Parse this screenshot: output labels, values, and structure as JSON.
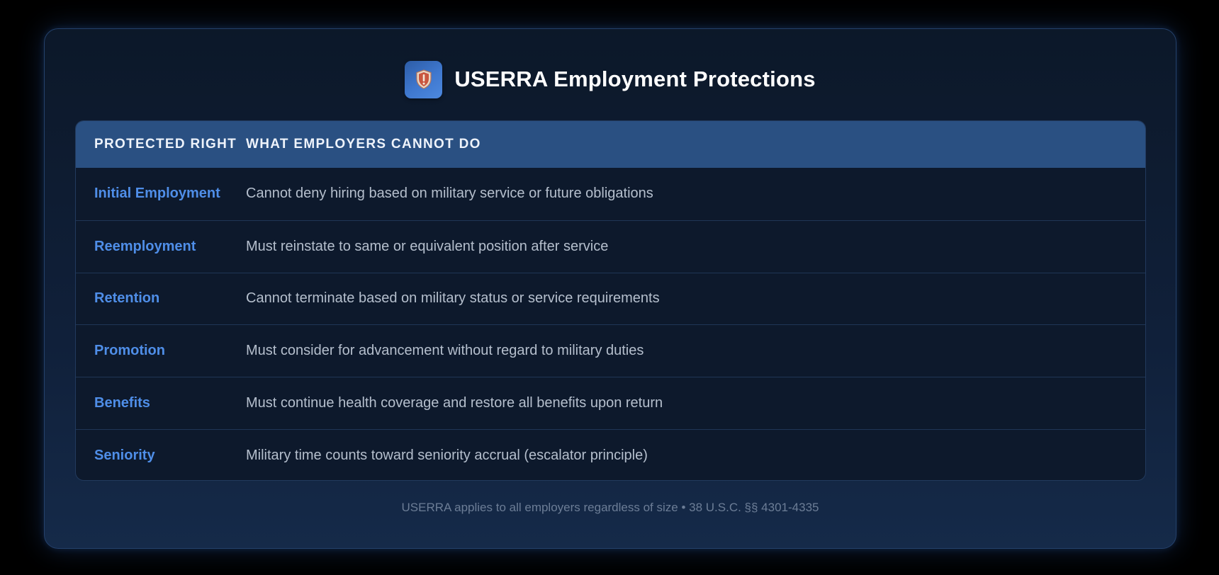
{
  "header": {
    "logo_icon": "shield-icon",
    "title": "USERRA Employment Protections"
  },
  "table": {
    "columns": [
      "PROTECTED RIGHT",
      "WHAT EMPLOYERS CANNOT DO"
    ],
    "rows": [
      {
        "right": "Initial Employment",
        "description": "Cannot deny hiring based on military service or future obligations"
      },
      {
        "right": "Reemployment",
        "description": "Must reinstate to same or equivalent position after service"
      },
      {
        "right": "Retention",
        "description": "Cannot terminate based on military status or service requirements"
      },
      {
        "right": "Promotion",
        "description": "Must consider for advancement without regard to military duties"
      },
      {
        "right": "Benefits",
        "description": "Must continue health coverage and restore all benefits upon return"
      },
      {
        "right": "Seniority",
        "description": "Military time counts toward seniority accrual (escalator principle)"
      }
    ]
  },
  "footer": {
    "note": "USERRA applies to all employers regardless of size • 38 U.S.C. §§ 4301-4335"
  },
  "colors": {
    "accent": "#4f8ee8",
    "header_bg": "#2a5082",
    "card_bg": "#0c1829"
  }
}
